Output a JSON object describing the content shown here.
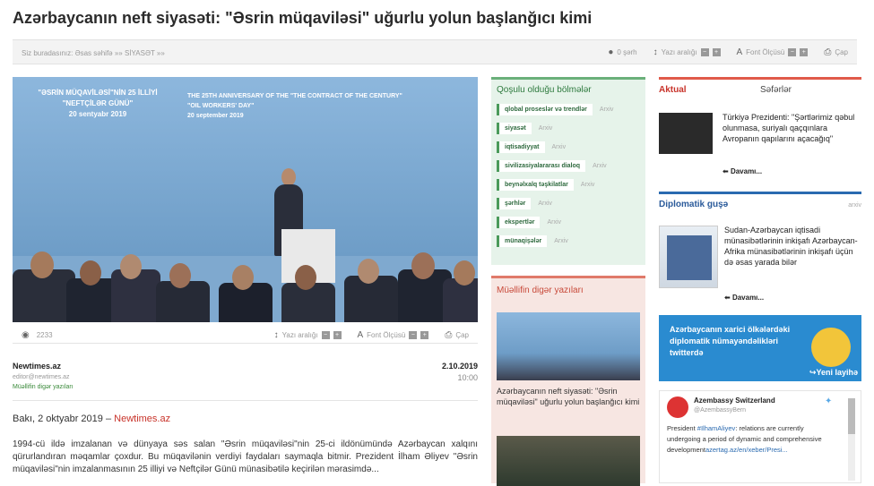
{
  "title": "Azərbaycanın neft siyasəti: \"Əsrin müqaviləsi\" uğurlu yolun başlanğıcı kimi",
  "toolbar": {
    "breadcrumb": "Siz buradasınız: Əsas səhifə »» SİYASƏT »»",
    "comments": "0 şərh",
    "line_spacing": "Yazı aralığı",
    "font_size": "Font Ölçüsü",
    "print": "Çap"
  },
  "hero": {
    "stage_left": "\"ƏSRİN MÜQAVİLƏSİ\"NİN 25 İLLİYİ\n\"NEFTÇİLƏR GÜNÜ\"\n20 sentyabr 2019",
    "stage_right": "THE 25TH ANNIVERSARY OF THE \"THE CONTRACT OF THE CENTURY\"\n\"OIL WORKERS' DAY\"\n20 september 2019"
  },
  "meta": {
    "views": "2233",
    "line_spacing": "Yazı aralığı",
    "font_size": "Font Ölçüsü",
    "print": "Çap"
  },
  "author": {
    "name": "Newtimes.az",
    "email": "editor@newtimes.az",
    "link": "Müəllifin digər yazıları",
    "date": "2.10.2019",
    "time": "10:00"
  },
  "article": {
    "lead_prefix": "Bakı, 2 oktyabr 2019 – ",
    "lead_source": "Newtimes.az",
    "body": "1994-cü ildə imzalanan və dünyaya səs salan \"Əsrin müqaviləsi\"nin 25-ci ildönümündə Azərbaycan xalqını qürurlandıran məqamlar çoxdur. Bu müqavilənin verdiyi faydaları saymaqla bitmir. Prezident İlham Əliyev \"Əsrin müqaviləsi\"nin imzalanmasının 25 illiyi və Neftçilər Günü münasibətilə keçirilən mərasimdə..."
  },
  "sections": {
    "heading": "Qoşulu olduğu bölmələr",
    "archive_label": "Arxiv",
    "items": [
      "qlobal proseslər və trendlər",
      "siyasət",
      "iqtisadiyyat",
      "sivilizasiyalararası dialoq",
      "beynəlxalq təşkilatlar",
      "şərhlər",
      "ekspertlər",
      "münaqişələr"
    ]
  },
  "other_articles": {
    "heading": "Müəllifin digər yazıları",
    "item1_caption": "Azərbaycanın neft siyasəti: \"Əsrin müqaviləsi\" uğurlu yolun başlanğıcı kimi"
  },
  "right": {
    "tab_actual": "Aktual",
    "tab_trips": "Səfərlər",
    "news1": "Türkiyə Prezidenti: \"Şərtlərimiz qəbul olunmasa, suriyalı qaçqınlara Avropanın qapılarını açacağıq\"",
    "more": "Davamı...",
    "diplomatic_heading": "Diplomatik guşə",
    "diplomatic_archive": "arxiv",
    "diplomatic_news": "Sudan-Azərbaycan iqtisadi münasibətlərinin inkişafı Azərbaycan-Afrika münasibətlərinin inkişafı üçün də əsas yarada bilər",
    "twitter_banner": "Azərbaycanın xarici ölkələrdəki diplomatik nümayəndəlikləri twitterdə",
    "twitter_more": "Yeni layihə",
    "tweet_name": "Azembassy Switzerland",
    "tweet_handle": "@AzembassyBern",
    "tweet_text_1": "President ",
    "tweet_mention": "#IlhamAliyev",
    "tweet_text_2": ": relations are currently undergoing a period of dynamic and comprehensive development",
    "tweet_link": "azertag.az/en/xeber/Presi..."
  }
}
